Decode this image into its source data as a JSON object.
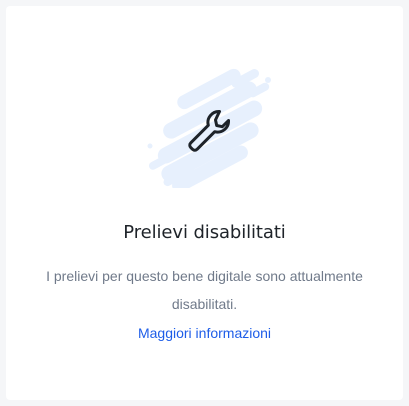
{
  "card": {
    "title": "Prelievi disabilitati",
    "description": "I prelievi per questo bene digitale sono attualmente disabilitati.",
    "link_label": "Maggiori informazioni",
    "illustration_icon": "wrench-icon"
  },
  "colors": {
    "background": "#f5f6f8",
    "card": "#ffffff",
    "title": "#1e2329",
    "text_muted": "#707a8a",
    "link": "#1e5de8",
    "splash": "#e7f0fd",
    "icon_stroke": "#1e2329"
  }
}
